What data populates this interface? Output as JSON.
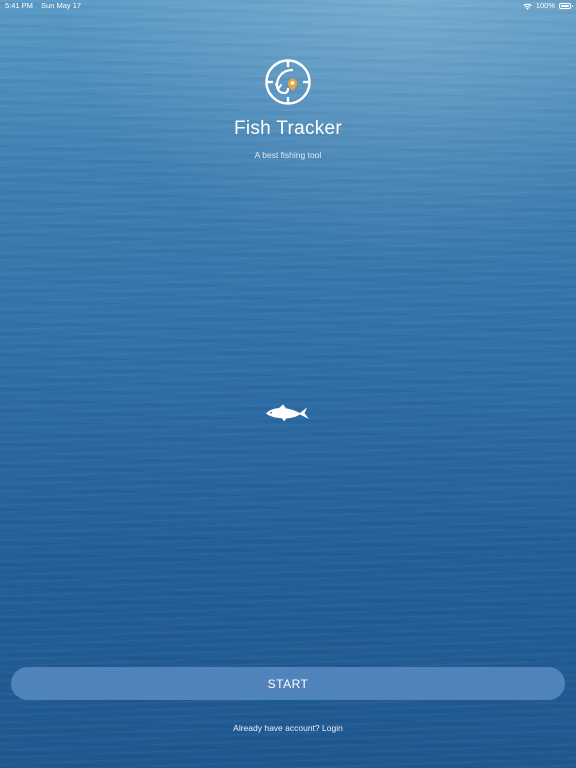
{
  "status_bar": {
    "time": "5:41 PM",
    "date": "Sun May 17",
    "battery": "100%",
    "battery_level": 1.0,
    "icons": [
      "wifi-icon",
      "battery-icon"
    ]
  },
  "app": {
    "title": "Fish Tracker",
    "subtitle": "A best fishing tool",
    "logo_icon": "fishing-target-icon",
    "fish_icon": "fish-icon"
  },
  "actions": {
    "start_label": "START",
    "login_text": "Already have account? Login"
  },
  "colors": {
    "logo_accent": "#e9a53c",
    "button_bg": "#5c8cc4",
    "text": "#ffffff"
  }
}
